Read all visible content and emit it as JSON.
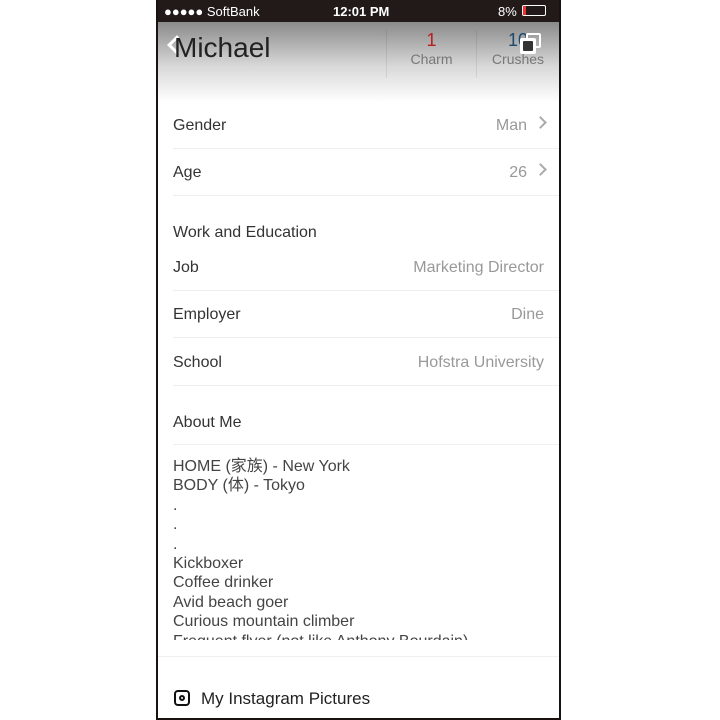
{
  "status_bar": {
    "carrier": "●●●●● SoftBank",
    "time": "12:01 PM",
    "battery": "8%"
  },
  "header": {
    "title": "Michael",
    "charm_count": "1",
    "charm_label": "Charm",
    "crushes_count": "10",
    "crushes_label": "Crushes",
    "charm_color": "#b52020",
    "crushes_color": "#1c4a6a"
  },
  "basic": [
    {
      "label": "Gender",
      "value": "Man"
    },
    {
      "label": "Age",
      "value": "26"
    }
  ],
  "work": {
    "title": "Work and Education",
    "rows": [
      {
        "label": "Job",
        "value": "Marketing Director"
      },
      {
        "label": "Employer",
        "value": "Dine"
      },
      {
        "label": "School",
        "value": "Hofstra University"
      }
    ]
  },
  "about": {
    "title": "About Me",
    "lines": [
      "HOME (家族) -  New York",
      "BODY (体) - Tokyo",
      ".",
      ".",
      ".",
      "Kickboxer",
      "Coffee drinker",
      "Avid beach goer",
      "Curious mountain climber",
      "Frequent flyer (not like Anthony Bourdain)"
    ]
  },
  "instagram": {
    "label": "My Instagram Pictures",
    "icon": "instagram-icon"
  }
}
